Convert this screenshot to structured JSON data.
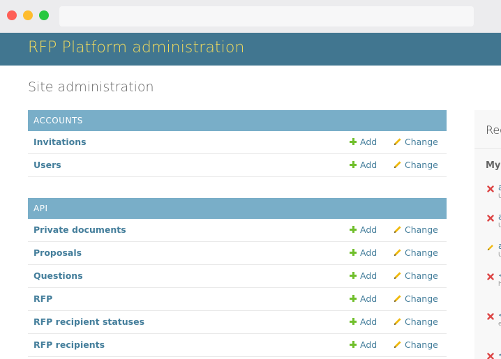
{
  "header": {
    "brand": "RFP Platform administration"
  },
  "page": {
    "title": "Site administration"
  },
  "modules": [
    {
      "caption": "Accounts",
      "models": [
        {
          "name": "Invitations",
          "add_label": "Add",
          "change_label": "Change"
        },
        {
          "name": "Users",
          "add_label": "Add",
          "change_label": "Change"
        }
      ]
    },
    {
      "caption": "API",
      "models": [
        {
          "name": "Private documents",
          "add_label": "Add",
          "change_label": "Change"
        },
        {
          "name": "Proposals",
          "add_label": "Add",
          "change_label": "Change"
        },
        {
          "name": "Questions",
          "add_label": "Add",
          "change_label": "Change"
        },
        {
          "name": "RFP",
          "add_label": "Add",
          "change_label": "Change"
        },
        {
          "name": "RFP recipient statuses",
          "add_label": "Add",
          "change_label": "Change"
        },
        {
          "name": "RFP recipients",
          "add_label": "Add",
          "change_label": "Change"
        }
      ]
    }
  ],
  "sidebar": {
    "recent_title": "Rec",
    "my_title": "My",
    "actions": [
      {
        "icon": "delete-icon",
        "line1": "a",
        "line2": "U"
      },
      {
        "icon": "delete-icon",
        "line1": "a",
        "line2": "U"
      },
      {
        "icon": "change-icon",
        "line1": "a",
        "line2": "U"
      },
      {
        "icon": "delete-icon",
        "line1": "<",
        "line2": "h"
      },
      {
        "icon": "delete-icon",
        "line1": "<",
        "line2": "e"
      },
      {
        "icon": "delete-icon",
        "line1": "<",
        "line2": ""
      }
    ]
  },
  "colors": {
    "header_bg": "#417690",
    "brand_text": "#f5dd5d",
    "module_caption_bg": "#79aec8",
    "link": "#447e9b",
    "add_icon": "#70bf2b",
    "change_icon": "#efb80b",
    "delete_icon": "#dd4646"
  }
}
